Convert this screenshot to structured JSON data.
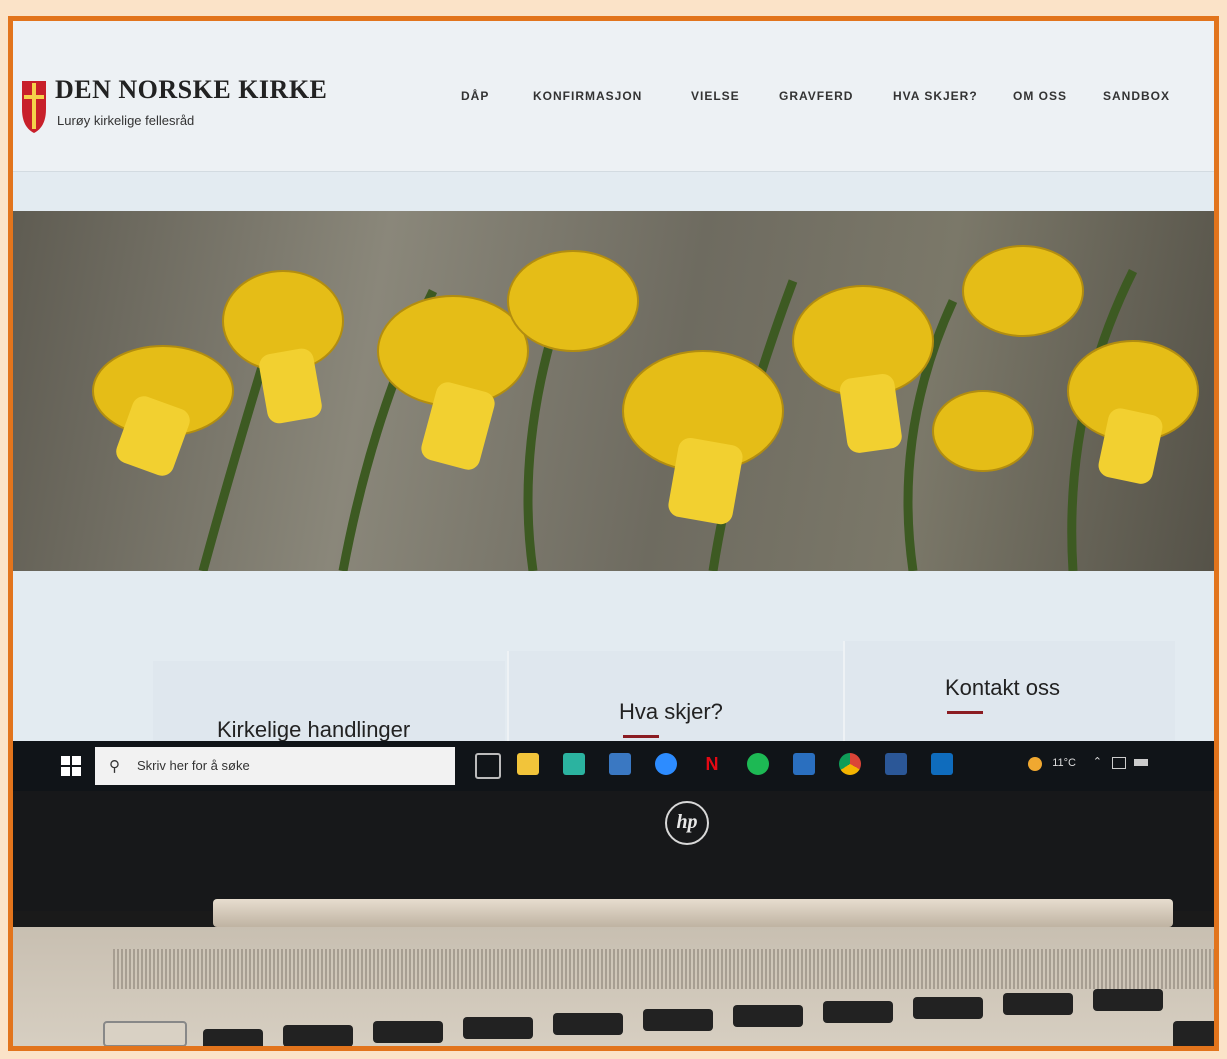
{
  "site": {
    "title": "DEN NORSKE KIRKE",
    "subtitle": "Lurøy kirkelige fellesråd"
  },
  "nav": {
    "items": [
      {
        "label": "DÅP"
      },
      {
        "label": "KONFIRMASJON"
      },
      {
        "label": "VIELSE"
      },
      {
        "label": "GRAVFERD"
      },
      {
        "label": "HVA SKJER?"
      },
      {
        "label": "OM OSS"
      },
      {
        "label": "SANDBOX"
      }
    ]
  },
  "cards": [
    {
      "title": "Kirkelige handlinger"
    },
    {
      "title": "Hva skjer?"
    },
    {
      "title": "Kontakt oss"
    }
  ],
  "taskbar": {
    "search_placeholder": "Skriv her for å søke",
    "weather": "11°C",
    "tray_icons": [
      "weather-icon",
      "chevron-up-icon",
      "network-icon",
      "battery-icon"
    ]
  },
  "laptop": {
    "brand_logo": "hp"
  },
  "colors": {
    "accent_red": "#8b1c22",
    "frame_orange": "#e2741c",
    "daffodil_yellow": "#e8c21c"
  }
}
